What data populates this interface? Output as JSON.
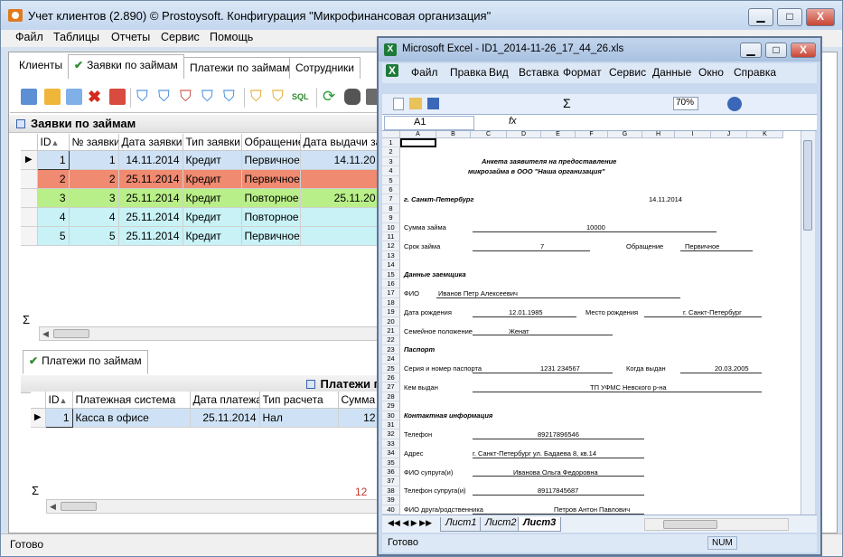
{
  "app": {
    "title": "Учет клиентов (2.890) © Prostoysoft. Конфигурация \"Микрофинансовая организация\"",
    "min_label": "▁",
    "max_label": "□",
    "close_label": "X"
  },
  "menu": [
    "Файл",
    "Таблицы",
    "Отчеты",
    "Сервис",
    "Помощь"
  ],
  "tabs": [
    "Клиенты",
    "Заявки по займам",
    "Платежи по займам",
    "Сотрудники"
  ],
  "loans": {
    "title": "Заявки по займам",
    "columns": [
      "ID",
      "№ заявки",
      "Дата заявки",
      "Тип заявки",
      "Обращение",
      "Дата выдачи зай"
    ],
    "rows": [
      {
        "id": "1",
        "num": "1",
        "date": "14.11.2014",
        "type": "Кредит",
        "appeal": "Первичное",
        "issued": "14.11.20",
        "color": "#cfe2f5"
      },
      {
        "id": "2",
        "num": "2",
        "date": "25.11.2014",
        "type": "Кредит",
        "appeal": "Первичное",
        "issued": "",
        "color": "#f08a70"
      },
      {
        "id": "3",
        "num": "3",
        "date": "25.11.2014",
        "type": "Кредит",
        "appeal": "Повторное",
        "issued": "25.11.20",
        "color": "#b9ef88"
      },
      {
        "id": "4",
        "num": "4",
        "date": "25.11.2014",
        "type": "Кредит",
        "appeal": "Повторное",
        "issued": "",
        "color": "#c8f2f6"
      },
      {
        "id": "5",
        "num": "5",
        "date": "25.11.2014",
        "type": "Кредит",
        "appeal": "Первичное",
        "issued": "",
        "color": "#c8f2f6"
      }
    ],
    "sigma": "Σ"
  },
  "payments": {
    "tab": "Платежи по займам",
    "title": "Платежи г",
    "columns": [
      "ID",
      "Платежная система",
      "Дата платежа",
      "Тип расчета",
      "Сумма с"
    ],
    "rows": [
      {
        "id": "1",
        "system": "Касса в офисе",
        "date": "25.11.2014",
        "calc": "Нал",
        "sum": "12"
      }
    ],
    "sigma": "Σ",
    "total": "12"
  },
  "status": "Готово",
  "excel": {
    "title": "Microsoft Excel - ID1_2014-11-26_17_44_26.xls",
    "menu": [
      "Файл",
      "Правка",
      "Вид",
      "Вставка",
      "Формат",
      "Сервис",
      "Данные",
      "Окно",
      "Справка"
    ],
    "zoom": "70%",
    "cell_ref": "A1",
    "fx": "fx",
    "columns": [
      "A",
      "B",
      "C",
      "D",
      "E",
      "F",
      "G",
      "H",
      "I",
      "J",
      "K"
    ],
    "rows": [
      "1",
      "2",
      "3",
      "4",
      "5",
      "6",
      "7",
      "8",
      "9",
      "10",
      "11",
      "12",
      "13",
      "14",
      "15",
      "16",
      "17",
      "18",
      "19",
      "20",
      "21",
      "22",
      "23",
      "24",
      "25",
      "26",
      "27",
      "28",
      "29",
      "30",
      "31",
      "32",
      "33",
      "34",
      "35",
      "36",
      "37",
      "38",
      "39",
      "40"
    ],
    "doc": {
      "heading1": "Анкета заявителя на предоставление",
      "heading2": "микрозайма в ООО \"Наша организация\"",
      "city": "г. Санкт-Петербург",
      "date": "14.11.2014",
      "sum_label": "Сумма займа",
      "sum": "10000",
      "term_label": "Срок займа",
      "term": "7",
      "appeal_label": "Обращение",
      "appeal": "Первичное",
      "borrower": "Данные заемщика",
      "fio_label": "ФИО",
      "fio": "Иванов Петр Алексеевич",
      "birth_label": "Дата рождения",
      "birth": "12.01.1985",
      "birthplace_label": "Место рождения",
      "birthplace": "г. Санкт-Петербург",
      "marital_label": "Семейное положение",
      "marital": "Женат",
      "passport": "Паспорт",
      "pass_num_label": "Серия и номер паспорта",
      "pass_num": "1231 234567",
      "issued_when_label": "Когда выдан",
      "issued_when": "20.03.2005",
      "issued_by_label": "Кем выдан",
      "issued_by": "ТП УФМС Невского р-на",
      "contact": "Контактная информация",
      "phone_label": "Телефон",
      "phone": "89217896546",
      "addr_label": "Адрес",
      "addr": "г. Санкт-Петербург ул. Бадаева 8, кв.14",
      "spouse_label": "ФИО супруга(и)",
      "spouse": "Иванова Ольга Федоровна",
      "spouse_phone_label": "Телефон супруга(и)",
      "spouse_phone": "89117845687",
      "friend_label": "ФИО друга/родственника",
      "friend": "Петров Антон Павлович"
    },
    "sheets": [
      "Лист1",
      "Лист2",
      "Лист3"
    ],
    "status": "Готово",
    "num": "NUM"
  }
}
